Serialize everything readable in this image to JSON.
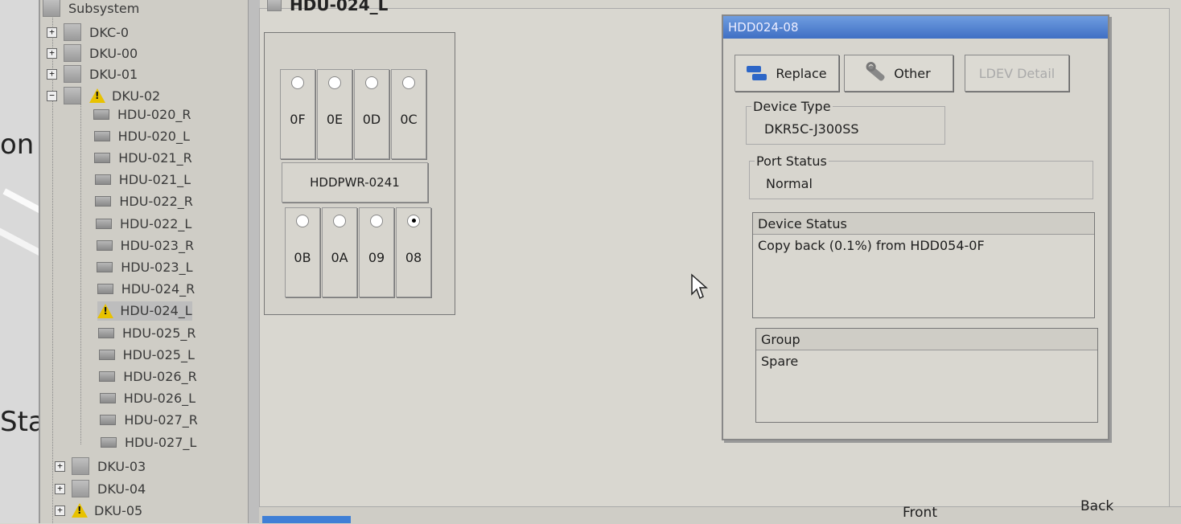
{
  "left_fragment": {
    "top": "on",
    "bottom": "Sta"
  },
  "tree": {
    "root": "Subsystem",
    "nodes": [
      {
        "label": "DKC-0",
        "expander": "+"
      },
      {
        "label": "DKU-00",
        "expander": "+"
      },
      {
        "label": "DKU-01",
        "expander": "+"
      },
      {
        "label": "DKU-02",
        "expander": "−",
        "warning": true
      }
    ],
    "hdus": [
      "HDU-020_R",
      "HDU-020_L",
      "HDU-021_R",
      "HDU-021_L",
      "HDU-022_R",
      "HDU-022_L",
      "HDU-023_R",
      "HDU-023_L",
      "HDU-024_R",
      "HDU-024_L",
      "HDU-025_R",
      "HDU-025_L",
      "HDU-026_R",
      "HDU-026_L",
      "HDU-027_R",
      "HDU-027_L"
    ],
    "selected_hdu": "HDU-024_L",
    "after": [
      {
        "label": "DKU-03",
        "expander": "+"
      },
      {
        "label": "DKU-04",
        "expander": "+"
      },
      {
        "label": "DKU-05",
        "expander": "+",
        "warning": true
      }
    ]
  },
  "breadcrumb": "HDU-024_L",
  "bay": {
    "top_slots": [
      "0F",
      "0E",
      "0D",
      "0C"
    ],
    "psu": "HDDPWR-0241",
    "bottom_slots": [
      "0B",
      "0A",
      "09",
      "08"
    ],
    "active_slot": "08"
  },
  "dialog": {
    "title": "HDD024-08",
    "buttons": {
      "replace": "Replace",
      "other": "Other",
      "ldev_detail": "LDEV Detail"
    },
    "device_type": {
      "label": "Device Type",
      "value": "DKR5C-J300SS"
    },
    "port_status": {
      "label": "Port Status",
      "value": "Normal"
    },
    "device_status": {
      "label": "Device Status",
      "value": "Copy back (0.1%) from HDD054-0F"
    },
    "group": {
      "label": "Group",
      "value": "Spare"
    }
  },
  "footer": {
    "front": "Front",
    "back": "Back"
  },
  "colors": {
    "title_bar": "#3f6fc4",
    "warning": "#e8c200",
    "footer_accent": "#3f7fd6"
  }
}
